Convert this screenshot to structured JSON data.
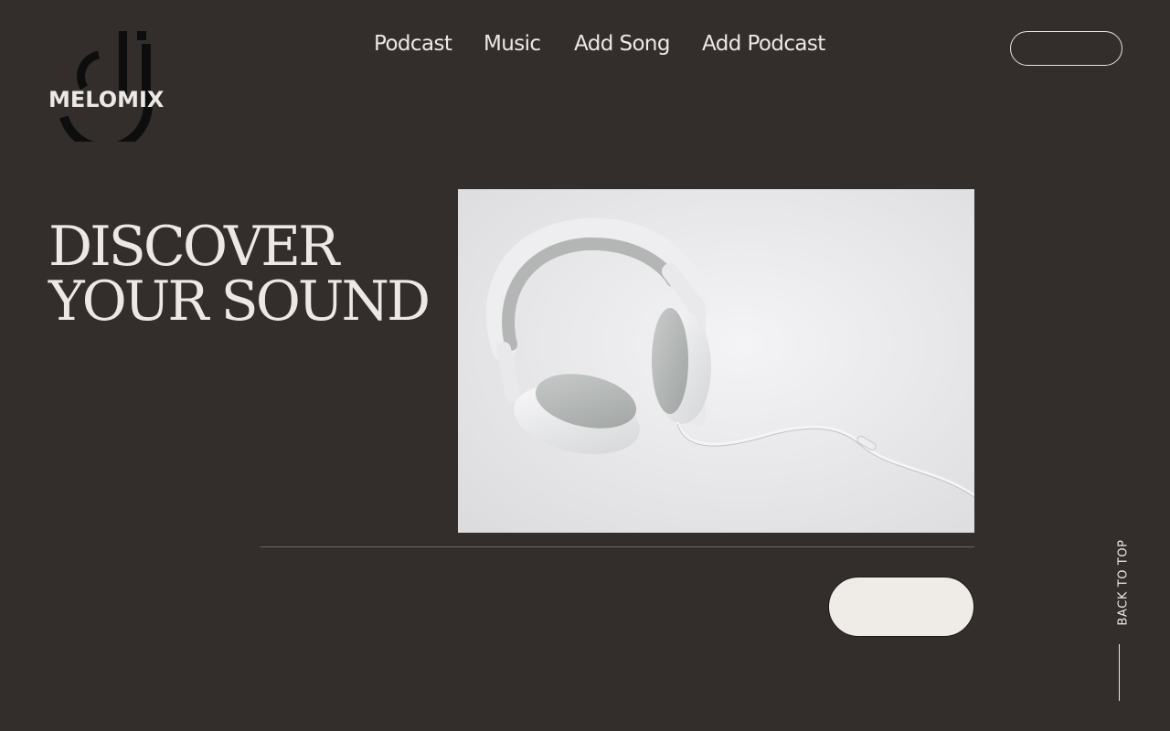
{
  "brand": {
    "name": "MELOMIX",
    "logo_icon": "dj-monogram-icon"
  },
  "nav": {
    "items": [
      {
        "label": "Podcast"
      },
      {
        "label": "Music"
      },
      {
        "label": "Add Song"
      },
      {
        "label": "Add Podcast"
      }
    ]
  },
  "hero": {
    "title_line1": "DISCOVER",
    "title_line2": "YOUR SOUND",
    "image_subject": "white-headphones-image"
  },
  "back_to_top": {
    "label": "BACK TO TOP"
  },
  "colors": {
    "background": "#332e2c",
    "text": "#ece8e4",
    "button_fill": "#efebe7",
    "divider": "#6b6562"
  }
}
